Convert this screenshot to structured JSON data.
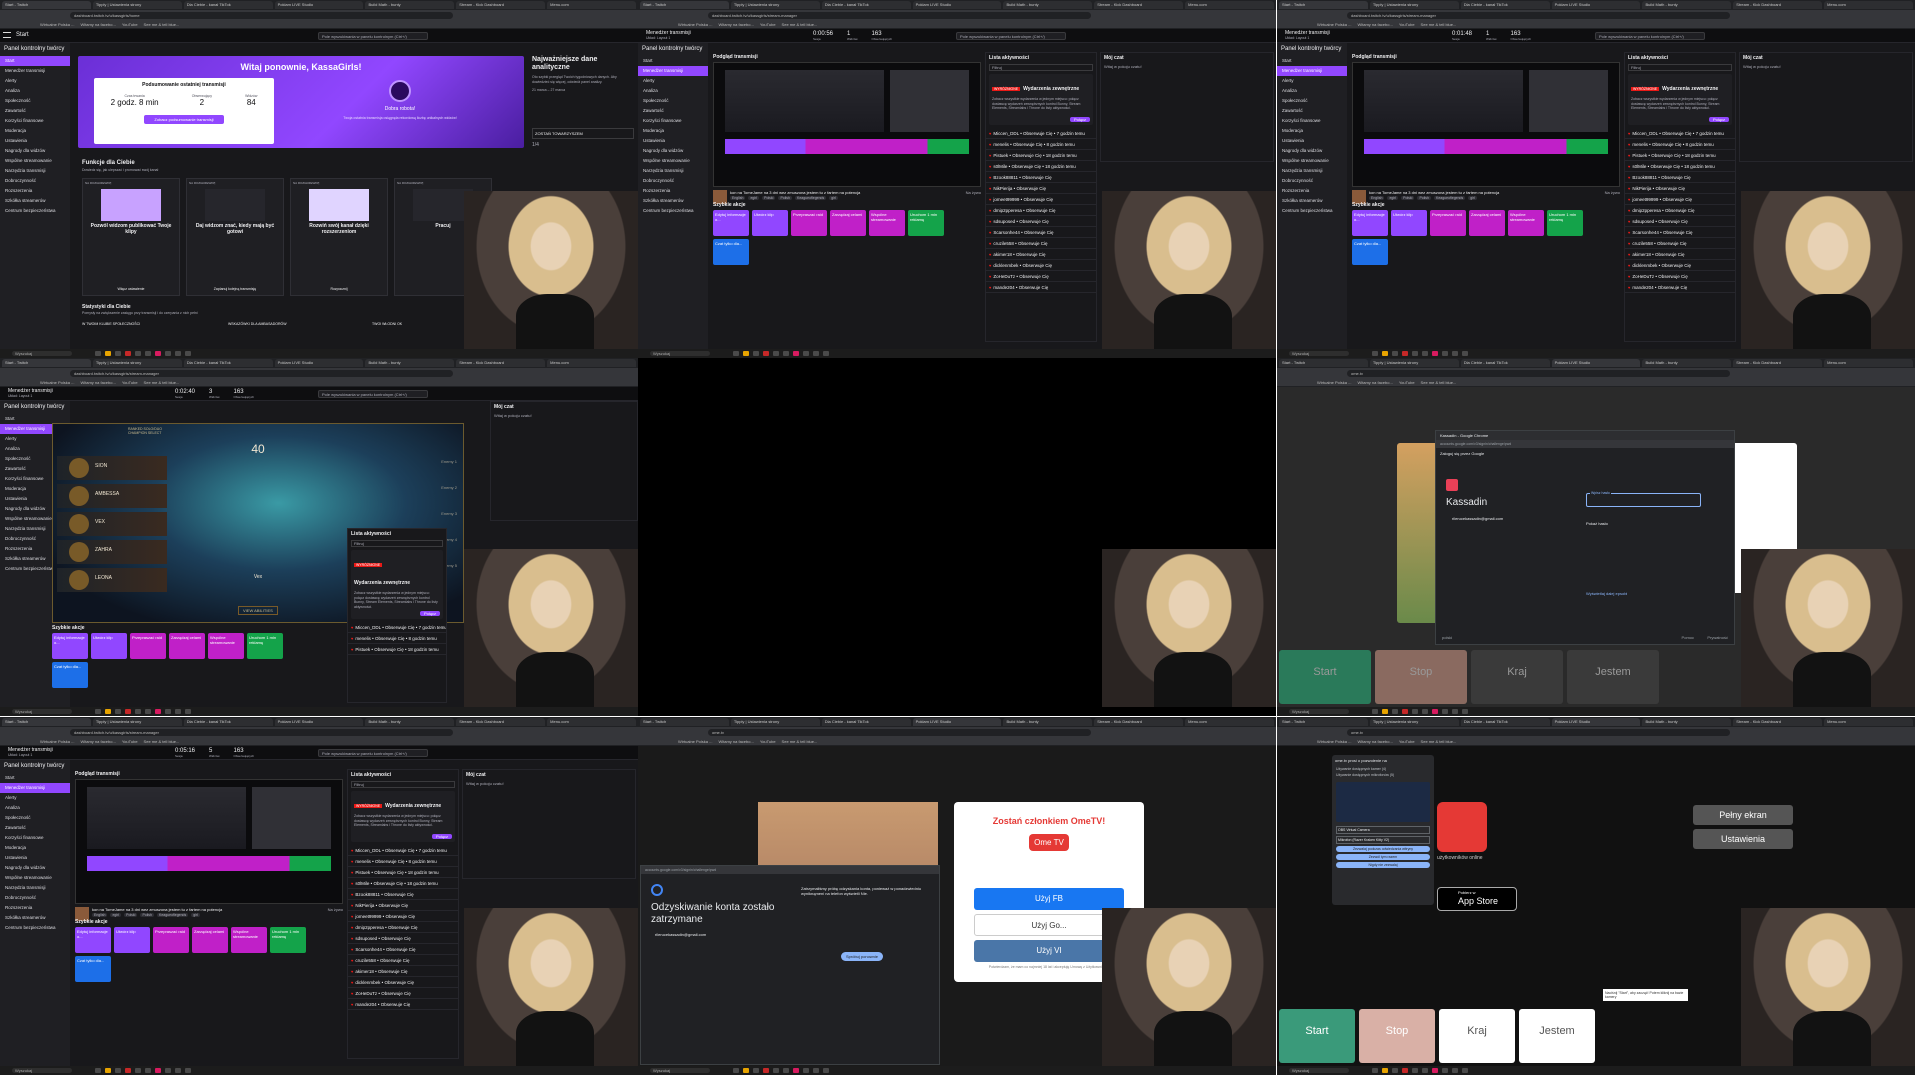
{
  "browser_tabs": [
    "Start - Twitch",
    "Tipply | Ustawienia strony",
    "Dla Ciebie - kanał TikTok",
    "Poklam LIVE Studio",
    "Build Math - bunty",
    "Stream - Kick Dashboard",
    "Menu.com"
  ],
  "address": {
    "dashboard_home": "dashboard.twitch.tv/u/kassgirls/home",
    "stream_manager": "dashboard.twitch.tv/u/kassgirls/stream-manager",
    "omegle": "ome.tv",
    "google_accounts": "accounts.google.com/v3/signin/challenge/pwd"
  },
  "bookmarks": [
    "Wirtualne Polska ...",
    "Witamy na facebo...",
    "YouTube",
    "See me & tell blue..."
  ],
  "twitch": {
    "search_placeholder": "Pole wyszukiwania w panelu kontrolnym (Ctrl+/)",
    "creator_panel_title": "Panel kontrolny twórcy",
    "stream_manager_label": "Menedżer transmisji",
    "stream_manager_sub": "Układ: Layout 1",
    "sidebar_items": [
      "Start",
      "Menedżer transmisji",
      "Alerty",
      "Analiza",
      "Społeczność",
      "Zawartość",
      "Korzyści finansowe",
      "Moderacja",
      "Ustawienia",
      "Nagrody dla widzów",
      "Wspólne streamowanie",
      "Narzędzia transmisji",
      "Dobroczynność",
      "Rozszerzenia",
      "Szkółka streamerów",
      "Centrum bezpieczeństwa"
    ],
    "welcome": "Witaj ponownie, KassaGirls!",
    "summary_title": "Podsumowanie ostatniej transmisji",
    "summary_stats": [
      {
        "label": "Czas trwania",
        "value": "2 godz. 8 min"
      },
      {
        "label": "Obserwujący",
        "value": "2"
      },
      {
        "label": "Widzów",
        "value": "84"
      }
    ],
    "summary_button": "Zobacz podsumowanie transmisji",
    "good_job": "Dobra robota!",
    "good_job_sub": "Twoja ostatnia transmisja osiągnęła rekordową liczbę unikalnych widzów!",
    "analytics_title": "Najważniejsze dane analityczne",
    "analytics_text": "Oto szybki przegląd Twoich tygodniowych danych. Aby dowiedzieć się więcej, odwiedź panel analizy.",
    "analytics_dates": "21 marca – 27 marca",
    "companion_button": "ZOSTAŃ TOWARZYSZEM",
    "pagination": "1/4",
    "features_title": "Funkcje dla Ciebie",
    "features_sub": "Dowiedz się, jak ulepszać i promować swój kanał",
    "feature_cards": [
      {
        "tag": "NA ROZGRZEWKĘ",
        "title": "Pozwól widzom publikować Twoje klipy",
        "button": "Włącz ustawienie"
      },
      {
        "tag": "NA ROZGRZEWKĘ",
        "title": "Daj widzom znać, kiedy mają być gotowi",
        "button": "Zaplanuj kolejną transmisję"
      },
      {
        "tag": "NA ROZGRZEWKĘ",
        "title": "Rozwiń swój kanał dzięki rozszerzeniom",
        "button": "Rozpocznij"
      },
      {
        "tag": "NA ROZGRZEWKĘ",
        "title": "Pracuj",
        "button": ""
      }
    ],
    "stats_title": "Statystyki dla Ciebie",
    "stats_sub": "Pomysły na zwiększenie zasięgu przy transmisji i do czerpania z nich pełni",
    "community_label": "W TWOIM KLUBIE SPOŁECZNOŚCI",
    "ambassador_label": "WSKAZÓWKI DLA AMBASADORÓW",
    "news_label": "TWOI WŁODNI OK",
    "session_stats": [
      {
        "time": "0:00:56",
        "viewers": "1",
        "followers": "163"
      },
      {
        "time": "0:01:48",
        "viewers": "1",
        "followers": "163"
      },
      {
        "time": "0:02:40",
        "viewers": "3",
        "followers": "163"
      },
      {
        "time": "0:05:16",
        "viewers": "5",
        "followers": "163"
      }
    ],
    "stat_labels": [
      "Sesja",
      "Widzów",
      "Obserwujących",
      "Przepisywanie"
    ],
    "preview_title": "Podgląd transmisji",
    "activity_title": "Lista aktywności",
    "chat_title": "Mój czat",
    "chat_welcome": "Witaj w pokoju czatu!",
    "filter": "Filtruj",
    "featured_badge": "WYRÓŻNIONE",
    "featured_title": "Wydarzenia zewnętrzne",
    "featured_text": "Zobacz wszystkie wydarzenia w jednym miejscu: połącz dostawcę wydarzeń zewnętrznych kontrol Bunny, Stream Elements, Streamlabs i Throne do listy aktywności.",
    "connect_button": "Połącz",
    "activity": [
      "Miccen_DDL • Obserwuje Cię • 7 godzin temu",
      "menelis • Obserwuje Cię • 8 godzin temu",
      "Pistuek • Obserwuje Cię • 18 godzin temu",
      "s0lMile • Obserwuje Cię • 18 godzin temu",
      "Bzook88811 • Obserwuje Cię",
      "NikPierija • Obserwuje Cię",
      "jomeet99999 • Obserwuje Cię",
      "dmip2pperesa • Obserwuje Cię",
      "sdsuposed • Obserwuje Cię",
      "Scarsonhe44 • Obserwuje Cię",
      "cruzile558 • Obserwuje Cię",
      "akimer18 • Obserwuje Cię",
      "dicklenmbek • Obserwuje Cię",
      "ZoHeDuTz • Obserwuje Cię",
      "mande204 • Obserwuje Cię"
    ],
    "stream_title": "kon na TomeJame na 3 dni wez zmuszona jestem tu z fartem na potencja",
    "stream_tags": [
      "English",
      "egirl",
      "Polski",
      "Polish",
      "Keagueoflegends",
      "girl"
    ],
    "quick_actions_title": "Szybkie akcje",
    "quick_actions": [
      "Edytuj informacje o...",
      "Utwórz klip",
      "Przepraszać raid",
      "Zarządzaj celami",
      "Wspólne streamowanie",
      "Uruchom 1 min reklamę",
      "Czat tylko dla..."
    ],
    "live_badge": "Na żywo",
    "clip_button": "Klip"
  },
  "game": {
    "timer": "40",
    "mode_label": "RANKED SOLO/DUO CHAMPION SELECT",
    "players": [
      "SION",
      "AMBESSA",
      "VEX",
      "ZAHRA",
      "LEONA"
    ],
    "champion": "Vex",
    "view_abilities": "VIEW ABILITIES",
    "picks": [
      "Enemy 1",
      "Enemy 2",
      "Enemy 3",
      "Enemy 4",
      "Enemy 5"
    ]
  },
  "google": {
    "window_title": "Kassadin - Google Chrome",
    "signin_title": "Zaloguj się przez Google",
    "account_name": "Kassadin",
    "account_email": "rilerucekassadin@gmail.com",
    "password_label": "Wpisz hasło",
    "show_password": "Pokaż hasło",
    "forgot_link": "Wyświetlaj dalej epsobi",
    "language": "polski",
    "help": "Pomoc",
    "privacy": "Prywatność",
    "recovery_title": "Odzyskiwanie konta zostało zatrzymane",
    "recovery_text": "Zatrzymaliśmy próbę odzyskania konta, ponieważ w ponadzwiedniu wyniknąmeni na telefon wyświetli Nie.",
    "recovery_button": "Spróbuj ponownie"
  },
  "ometv": {
    "member_title": "Zostań członkiem OmeTV!",
    "logo": "Ome TV",
    "use_fb": "Użyj FB",
    "use_google": "Użyj Go...",
    "use_vk": "Użyj VI",
    "terms": "Potwierdzam, że mam co najmniej 18 lat i akceptuję Umowę z Użytkownikiem",
    "buttons": {
      "start": "Start",
      "stop": "Stop",
      "country": "Kraj",
      "gender": "Jestem"
    },
    "fullscreen": "Pełny ekran",
    "settings": "Ustawienia",
    "app_store_small": "Pobierz w",
    "app_store": "App Store",
    "permission_title": "ome.tv prosi o pozwolenie na",
    "permission_items": [
      "Używanie dostępnych kamer (4)",
      "Używanie dostępnych mikrofonów (5)"
    ],
    "camera_select": "OBS Virtual Camera",
    "mic_select": "Mikrofon (Razer Kraken Kitty V2)",
    "allow_visit": "Zezwalaj podczas odwiedzania witryny",
    "allow_once": "Zezwól tym razem",
    "deny": "Nigdy nie zezwalaj",
    "notice": "Naciśnij \"Start\", aby zacząć! Potem kliknij na bazie kamery",
    "online_label": "użytkowników online"
  },
  "taskbar": {
    "search": "Wyszukaj"
  }
}
